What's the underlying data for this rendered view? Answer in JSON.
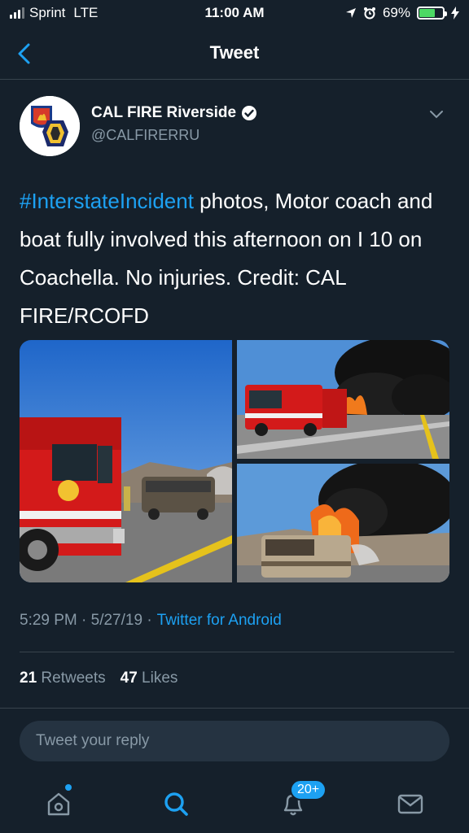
{
  "status_bar": {
    "carrier": "Sprint",
    "network": "LTE",
    "time": "11:00 AM",
    "battery_percent": "69%",
    "battery_level": 0.69,
    "battery_color": "#4cd964"
  },
  "header": {
    "title": "Tweet",
    "back_icon": "chevron-left-icon"
  },
  "tweet": {
    "author_name": "CAL FIRE Riverside",
    "author_handle": "@CALFIRERRU",
    "verified": true,
    "text_hashtag": "#InterstateIncident",
    "text_body": " photos, Motor coach and boat fully involved this afternoon on I 10 on Coachella.  No injuries.  Credit: CAL FIRE/RCOFD",
    "timestamp": "5:29 PM · 5/27/19 ·",
    "source": "Twitter for Android",
    "retweets_count": "21",
    "retweets_label": "Retweets",
    "likes_count": "47",
    "likes_label": "Likes",
    "photos": [
      {
        "desc_icon": "photo-fire-truck-icon"
      },
      {
        "desc_icon": "photo-fire-smoke-icon"
      },
      {
        "desc_icon": "photo-burning-coach-icon"
      }
    ]
  },
  "reply": {
    "placeholder": "Tweet your reply"
  },
  "tabbar": {
    "home_icon": "home-icon",
    "search_icon": "search-icon",
    "notifications_icon": "bell-icon",
    "notifications_badge": "20+",
    "messages_icon": "mail-icon"
  },
  "colors": {
    "background": "#15202b",
    "accent": "#1da1f2",
    "secondary_text": "#8899a6",
    "divider": "#38444d"
  }
}
